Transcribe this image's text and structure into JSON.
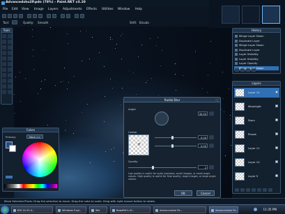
{
  "window": {
    "title": "Advancedsho2P.pdn (78%) - Paint.NET v3.10"
  },
  "menubar": [
    "File",
    "Edit",
    "View",
    "Image",
    "Layers",
    "Adjustments",
    "Effects",
    "Utilities",
    "Window",
    "Help"
  ],
  "tool_options": {
    "tool_label": "Tool:",
    "quality_label": "Quality:",
    "quality_value": "Smooth",
    "shift_label": "Shift:",
    "shift_value": "Bicubic"
  },
  "panels": {
    "tools": "Tools",
    "history": {
      "title": "History",
      "items": [
        {
          "label": "Merge Layer Down",
          "selected": false
        },
        {
          "label": "Duplicate Layer",
          "selected": false
        },
        {
          "label": "Merge Layer Down",
          "selected": false
        },
        {
          "label": "Duplicate Layer",
          "selected": false
        },
        {
          "label": "Layer Visibility",
          "selected": false
        },
        {
          "label": "Layer Visibility",
          "selected": false
        },
        {
          "label": "Layer Opacity",
          "selected": false
        },
        {
          "label": "Merge Layer Down",
          "selected": true
        }
      ]
    },
    "layers": {
      "title": "Layers",
      "items": [
        {
          "label": "Layer 14",
          "selected": true
        },
        {
          "label": "Moonlight",
          "selected": false
        },
        {
          "label": "Stars",
          "selected": false
        },
        {
          "label": "Planet",
          "selected": false
        },
        {
          "label": "Layer 11",
          "selected": false
        },
        {
          "label": "Layer 10",
          "selected": false
        },
        {
          "label": "Layer 9",
          "selected": false
        }
      ]
    },
    "colors": {
      "title": "Colors",
      "primary_label": "Primary",
      "more_label": "More >>"
    }
  },
  "dialog": {
    "title": "Radial Blur",
    "angle_label": "Angle",
    "angle_value": "30.00",
    "center_label": "Center",
    "center_x": "0.00",
    "center_y": "0.00",
    "quality_label": "Quality",
    "quality_value": "2",
    "hint": "Low quality is useful for quick previews, small images, or small angle values. High quality is useful for final quality, large images, or large angle values.",
    "ok": "OK",
    "cancel": "Cancel"
  },
  "status": {
    "text": "Move Selected Pixels: Drag the selection to move. Drag the nubs to scale. Drag with right mouse button to rotate."
  },
  "taskbar": {
    "items": [
      {
        "label": "EDI 14:10.4...",
        "active": false
      },
      {
        "label": "Windows Expl...",
        "active": false
      },
      {
        "label": "Wiz",
        "active": false
      },
      {
        "label": "BobaPet's UI...",
        "active": false
      },
      {
        "label": "Advancedsho Pa...",
        "active": false
      },
      {
        "label": "Advancedsho Pa...",
        "active": true
      }
    ],
    "clock": "11:35 PM"
  },
  "colors": {
    "accent": "#2f6fb4",
    "background": "#0b1622"
  }
}
